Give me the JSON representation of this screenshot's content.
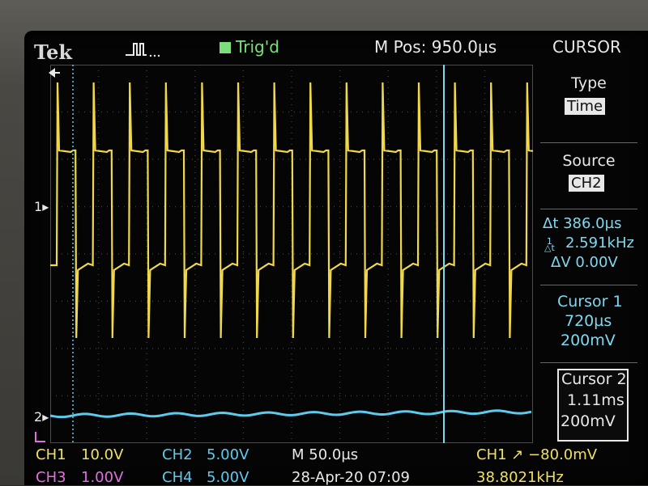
{
  "header": {
    "brand": "Tek",
    "trigger_status": "Trig'd",
    "position": "M Pos: 950.0µs",
    "menu_title": "CURSOR"
  },
  "menu": {
    "type_label": "Type",
    "type_value": "Time",
    "source_label": "Source",
    "source_value": "CH2",
    "delta_t": "Δt 386.0µs",
    "inv_delta_t": "2.591kHz",
    "delta_v": "ΔV 0.00V",
    "cursor1_label": "Cursor 1",
    "cursor1_time": "720µs",
    "cursor1_volt": "200mV",
    "cursor2_label": "Cursor 2",
    "cursor2_time": "1.11ms",
    "cursor2_volt": "200mV"
  },
  "markers": {
    "ch1": "1",
    "ch2": "2"
  },
  "status": {
    "ch1_label": "CH1",
    "ch1_scale": "10.0V",
    "ch2_label": "CH2",
    "ch2_scale": "5.00V",
    "timebase": "M 50.0µs",
    "trigger_info": "CH1 ↗ −80.0mV",
    "ch3_label": "CH3",
    "ch3_scale": "1.00V",
    "ch4_label": "CH4",
    "ch4_scale": "5.00V",
    "datetime": "28-Apr-20 07:09",
    "frequency": "38.8021kHz"
  },
  "colors": {
    "ch1": "#f0d84a",
    "ch2": "#5ecbee",
    "trigger": "#7be07b"
  },
  "icons": [
    "pulse-icon",
    "trigger-icon",
    "arrow-left-icon",
    "slope-icon",
    "ground-marker-icon"
  ]
}
